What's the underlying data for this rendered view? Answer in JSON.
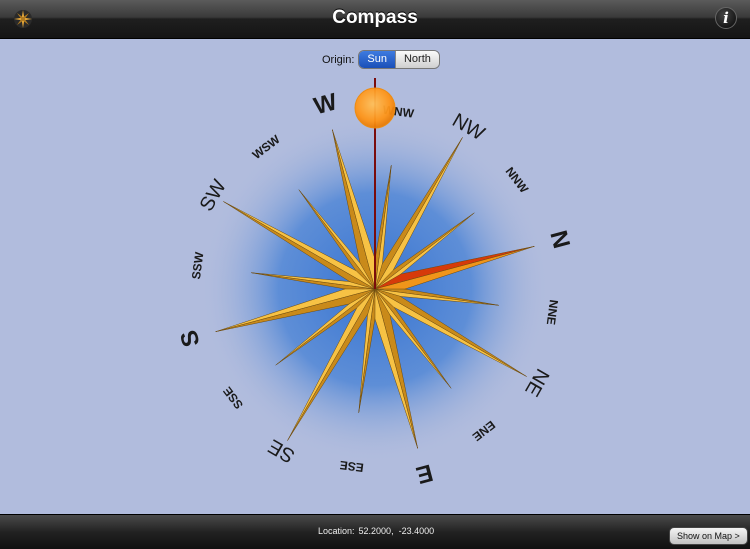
{
  "header": {
    "title": "Compass",
    "app_icon": "compass-rose-icon",
    "info_icon": "info-icon",
    "info_label": "i"
  },
  "origin": {
    "label": "Origin:",
    "options": [
      "Sun",
      "North"
    ],
    "selected": "Sun"
  },
  "compass": {
    "labels": [
      {
        "text": "N",
        "rot": 75
      },
      {
        "text": "NNE",
        "rot": 97.5
      },
      {
        "text": "NE",
        "rot": 120
      },
      {
        "text": "ENE",
        "rot": 142.5
      },
      {
        "text": "E",
        "rot": 165
      },
      {
        "text": "ESE",
        "rot": 187.5
      },
      {
        "text": "SE",
        "rot": 210
      },
      {
        "text": "SSE",
        "rot": 232.5
      },
      {
        "text": "S",
        "rot": 255
      },
      {
        "text": "SSW",
        "rot": 277.5
      },
      {
        "text": "SW",
        "rot": 300
      },
      {
        "text": "WSW",
        "rot": 322.5
      },
      {
        "text": "W",
        "rot": 345
      },
      {
        "text": "WNW",
        "rot": 7.5
      },
      {
        "text": "NW",
        "rot": 30
      },
      {
        "text": "NNW",
        "rot": 52.5
      }
    ],
    "colors": {
      "needle": "#7a0c0c",
      "sun": "#ff9a1f",
      "rose_gold": "#f7c244",
      "rose_shadow": "#c98a1a",
      "north_point": "#d63a0a",
      "glow": "#4f86d6"
    }
  },
  "footer": {
    "location_label": "Location:",
    "lat": "52.2000,",
    "lon": "-23.4000",
    "map_button": "Show on Map >"
  }
}
